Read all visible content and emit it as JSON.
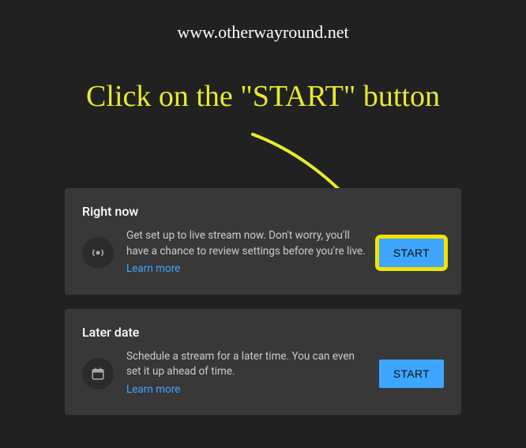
{
  "watermark": "www.otherwayround.net",
  "instruction": "Click on the \"START\" button",
  "colors": {
    "accent_yellow": "#e8ea2f",
    "button_blue": "#3ea6ff",
    "highlight_yellow": "#f2e400",
    "link_blue": "#3ea6ff"
  },
  "cards": {
    "rightNow": {
      "title": "Right now",
      "description": "Get set up to live stream now. Don't worry, you'll have a chance to review settings before you're live.",
      "learnMore": "Learn more",
      "button": "START",
      "icon": "broadcast-icon"
    },
    "laterDate": {
      "title": "Later date",
      "description": "Schedule a stream for a later time. You can even set it up ahead of time.",
      "learnMore": "Learn more",
      "button": "START",
      "icon": "calendar-icon"
    }
  }
}
